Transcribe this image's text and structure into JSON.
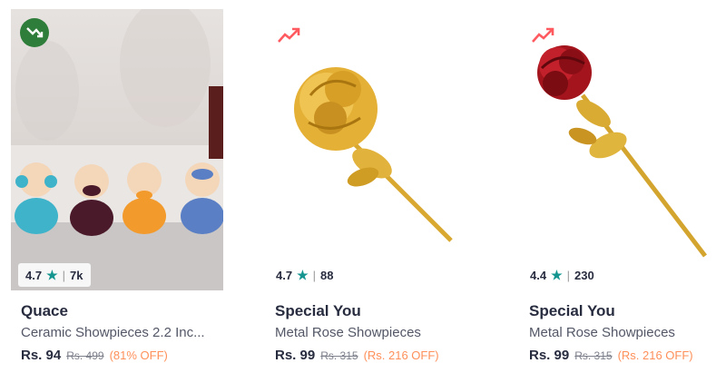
{
  "products": [
    {
      "brand": "Quace",
      "name": "Ceramic Showpieces 2.2 Inc...",
      "rating": "4.7",
      "rating_count": "7k",
      "price": "Rs. 94",
      "mrp": "Rs. 499",
      "discount": "(81% OFF)",
      "trend_icon": "trending-down-icon",
      "trend_color": "#2f7d3a"
    },
    {
      "brand": "Special You",
      "name": "Metal Rose Showpieces",
      "rating": "4.7",
      "rating_count": "88",
      "price": "Rs. 99",
      "mrp": "Rs. 315",
      "discount": "(Rs. 216 OFF)",
      "trend_icon": "trending-up-icon",
      "trend_color": "#ff5a5f"
    },
    {
      "brand": "Special You",
      "name": "Metal Rose Showpieces",
      "rating": "4.4",
      "rating_count": "230",
      "price": "Rs. 99",
      "mrp": "Rs. 315",
      "discount": "(Rs. 216 OFF)",
      "trend_icon": "trending-up-icon",
      "trend_color": "#ff5a5f"
    }
  ],
  "colors": {
    "rating_star": "#14958f",
    "discount": "#ff905a"
  }
}
